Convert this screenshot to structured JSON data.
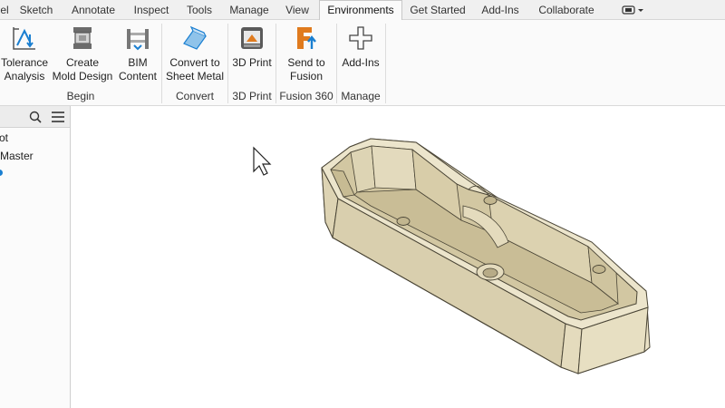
{
  "tabs": [
    {
      "label": "el"
    },
    {
      "label": "Sketch"
    },
    {
      "label": "Annotate"
    },
    {
      "label": "Inspect"
    },
    {
      "label": "Tools"
    },
    {
      "label": "Manage"
    },
    {
      "label": "View"
    },
    {
      "label": "Environments",
      "active": true
    },
    {
      "label": "Get Started"
    },
    {
      "label": "Add-Ins"
    },
    {
      "label": "Collaborate"
    }
  ],
  "ribbon": {
    "begin": {
      "label": "Begin",
      "tolerance_analysis": "Tolerance\nAnalysis",
      "create_mold_design": "Create\nMold Design",
      "bim_content": "BIM\nContent"
    },
    "convert": {
      "label": "Convert",
      "convert_to_sheet_metal": "Convert to\nSheet Metal"
    },
    "print3d": {
      "label": "3D Print",
      "button": "3D Print"
    },
    "fusion": {
      "label": "Fusion 360",
      "send_to_fusion": "Send to\nFusion"
    },
    "manage": {
      "label": "Manage",
      "add_ins": "Add-Ins"
    }
  },
  "browser": {
    "items": [
      "ot",
      "Master"
    ]
  },
  "colors": {
    "part_fill": "#e9e1c6",
    "part_shade": "#d6ccaa",
    "part_dark": "#b9ae8b",
    "part_edge": "#4a4536",
    "accent_blue": "#1a7fd1",
    "fusion_orange": "#e07b1e"
  },
  "icons": [
    "search-icon",
    "menu-icon",
    "tolerance-analysis-icon",
    "mold-design-icon",
    "bim-content-icon",
    "sheet-metal-icon",
    "3d-print-icon",
    "send-to-fusion-icon",
    "add-ins-icon",
    "mouse-cursor-icon"
  ]
}
